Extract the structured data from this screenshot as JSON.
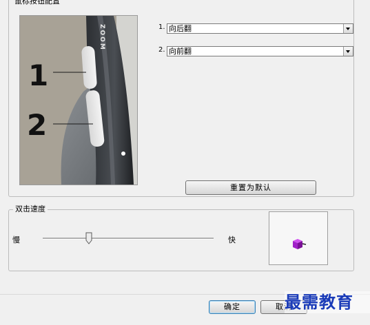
{
  "button_group": {
    "title": "鼠标按钮配置",
    "image_callouts": [
      "1",
      "2"
    ],
    "image_text": "ZOOM",
    "combos": [
      {
        "label": "1.",
        "value": "向后翻"
      },
      {
        "label": "2.",
        "value": "向前翻"
      }
    ],
    "reset_label": "重置为默认"
  },
  "speed_group": {
    "title": "双击速度",
    "slow_label": "慢",
    "fast_label": "快",
    "slider_value_percent": 27
  },
  "footer": {
    "ok_label": "确定",
    "cancel_label": "取消"
  },
  "watermark": "最需教育",
  "colors": {
    "picture_bg": "#a8a296",
    "test_object": "#a020c8",
    "watermark": "#1a3bb8"
  }
}
